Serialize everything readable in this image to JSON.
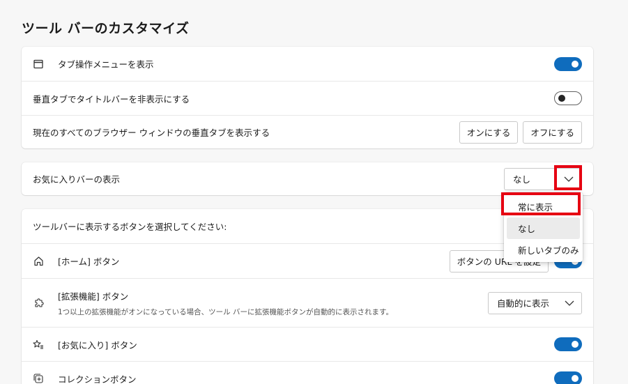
{
  "page": {
    "title": "ツール バーのカスタマイズ"
  },
  "card1": {
    "rows": [
      {
        "label": "タブ操作メニューを表示",
        "toggle": "on"
      },
      {
        "label": "垂直タブでタイトルバーを非表示にする",
        "toggle": "off"
      },
      {
        "label": "現在のすべてのブラウザー ウィンドウの垂直タブを表示する",
        "on_button": "オンにする",
        "off_button": "オフにする"
      }
    ]
  },
  "favorites_bar": {
    "label": "お気に入りバーの表示",
    "selected": "なし",
    "options": [
      "常に表示",
      "なし",
      "新しいタブのみ"
    ]
  },
  "toolbar_buttons": {
    "header": "ツールバーに表示するボタンを選択してください:",
    "home": {
      "label": "[ホーム] ボタン",
      "button": "ボタンの URL を設定",
      "toggle": "on"
    },
    "extensions": {
      "label": "[拡張機能] ボタン",
      "sublabel": "1つ以上の拡張機能がオンになっている場合、ツール バーに拡張機能ボタンが自動的に表示されます。",
      "selected": "自動的に表示"
    },
    "favorites": {
      "label": "[お気に入り] ボタン",
      "toggle": "on"
    },
    "collections": {
      "label": "コレクションボタン",
      "toggle": "on"
    }
  },
  "colors": {
    "accent": "#0f6cbd",
    "highlight": "#e60012"
  }
}
